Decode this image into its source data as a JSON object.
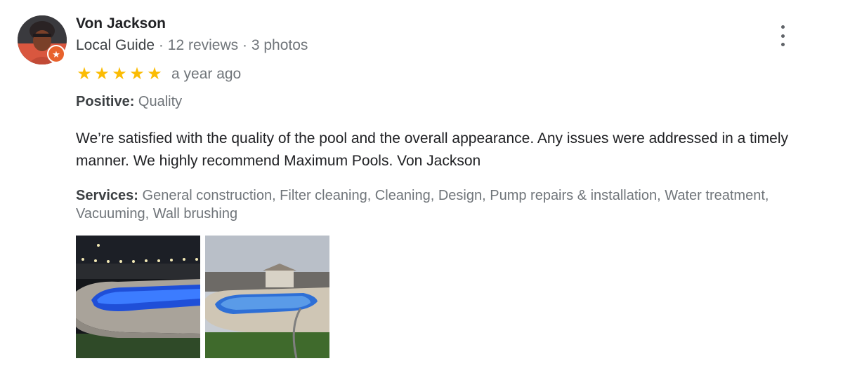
{
  "reviewer": {
    "name": "Von Jackson",
    "guide_label": "Local Guide",
    "separator": "·",
    "reviews": "12 reviews",
    "photos": "3 photos",
    "badge_icon": "local-guide-star-icon"
  },
  "rating": {
    "stars": 5,
    "out_of": 5,
    "date": "a year ago",
    "star_color": "#fbbc04"
  },
  "positive": {
    "label": "Positive:",
    "value": "Quality"
  },
  "text": "We’re satisfied with the quality of the pool and the overall appearance. Any issues were addressed in a timely manner. We highly recommend Maximum Pools. Von Jackson",
  "services": {
    "label": "Services:",
    "value": "General construction, Filter cleaning, Cleaning, Design, Pump repairs & installation, Water treatment, Vacuuming, Wall brushing"
  },
  "photos": [
    {
      "subject": "pool at night with blue lights"
    },
    {
      "subject": "pool during day"
    }
  ],
  "menu_icon": "more-vert-icon",
  "colors": {
    "name": "#202124",
    "secondary": "#70757a",
    "badge": "#e8622c"
  }
}
